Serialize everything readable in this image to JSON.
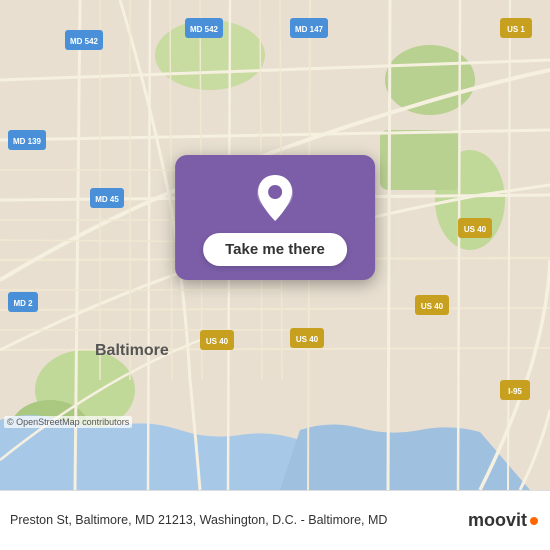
{
  "map": {
    "center_lat": 39.31,
    "center_lon": -76.61,
    "alt": "Map of Baltimore, MD area"
  },
  "button": {
    "label": "Take me there"
  },
  "footer": {
    "address": "Preston St, Baltimore, MD 21213, Washington, D.C. - Baltimore, MD"
  },
  "attribution": {
    "text": "© OpenStreetMap contributors"
  },
  "moovit": {
    "name": "moovit"
  }
}
